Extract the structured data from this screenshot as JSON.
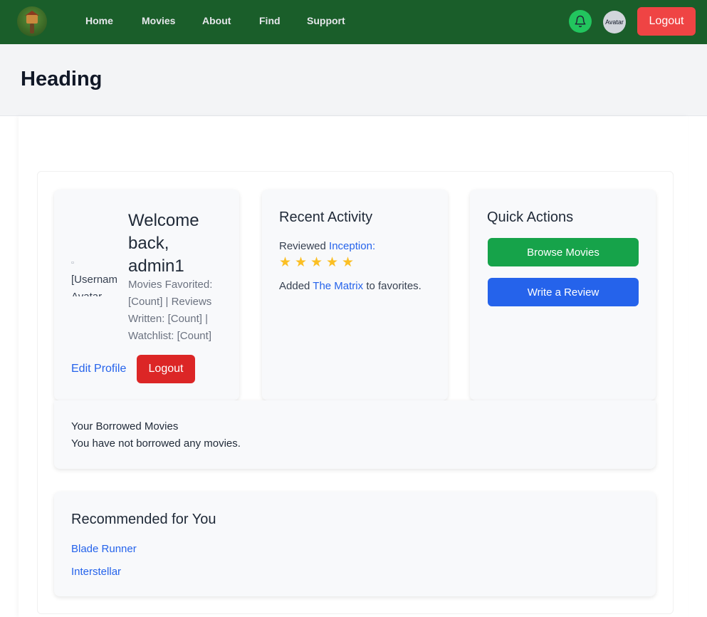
{
  "nav": {
    "links": [
      "Home",
      "Movies",
      "About",
      "Find",
      "Support"
    ],
    "avatar_label": "Avatar",
    "logout_label": "Logout",
    "accent_color": "#1a5e2a"
  },
  "header": {
    "title": "Heading"
  },
  "welcome": {
    "avatar_alt": "[Username] Avatar",
    "title": "Welcome back, admin1",
    "stats": "Movies Favorited: [Count] | Reviews Written: [Count] | Watchlist: [Count]",
    "edit_profile": "Edit Profile",
    "logout": "Logout"
  },
  "activity": {
    "heading": "Recent Activity",
    "reviewed_prefix": "Reviewed",
    "reviewed_movie": "Inception",
    "reviewed_suffix": ":",
    "rating_stars": 5,
    "added_prefix": "Added",
    "added_movie": "The Matrix",
    "added_suffix": "to favorites."
  },
  "quick_actions": {
    "heading": "Quick Actions",
    "browse": "Browse Movies",
    "write_review": "Write a Review"
  },
  "borrowed": {
    "heading": "Your Borrowed Movies",
    "empty_text": "You have not borrowed any movies."
  },
  "recommended": {
    "heading": "Recommended for You",
    "items": [
      "Blade Runner",
      "Interstellar"
    ]
  }
}
